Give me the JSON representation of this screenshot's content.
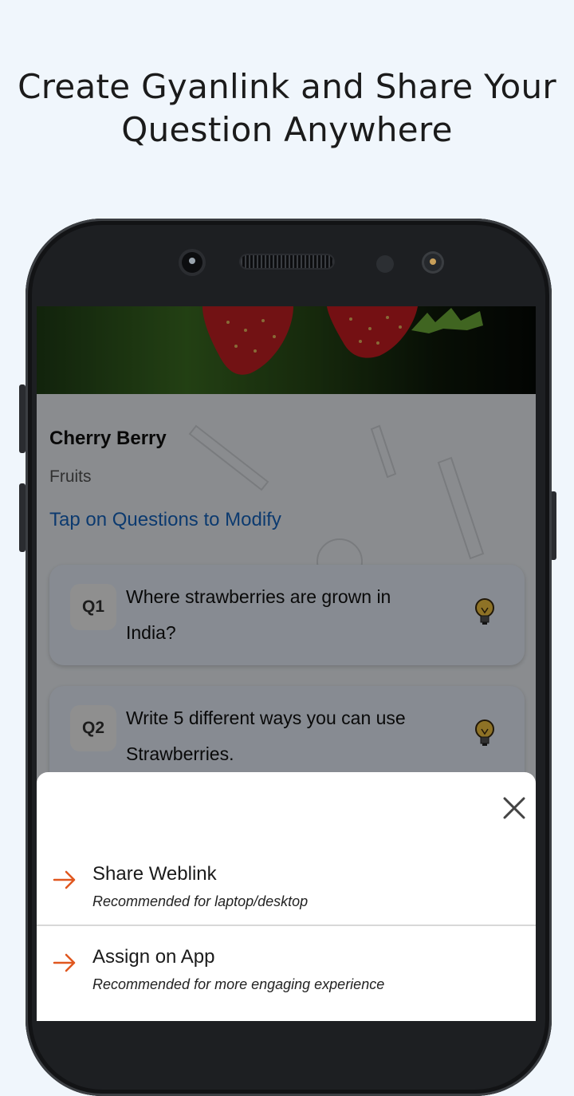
{
  "headline": {
    "line1": "Create Gyanlink and Share Your",
    "line2": "Question Anywhere"
  },
  "card": {
    "title": "Cherry Berry",
    "subtitle": "Fruits",
    "hint": "Tap on Questions to Modify"
  },
  "questions": [
    {
      "number": "Q1",
      "text": "Where strawberries are grown in India?",
      "icon": "lightbulb-icon"
    },
    {
      "number": "Q2",
      "text": "Write 5 different ways you can use Strawberries.",
      "icon": "lightbulb-icon"
    }
  ],
  "share_sheet": {
    "close_icon": "close-icon",
    "options": [
      {
        "title": "Share Weblink",
        "subtitle": "Recommended for laptop/desktop",
        "icon": "arrow-right-icon"
      },
      {
        "title": "Assign on App",
        "subtitle": "Recommended for more engaging experience",
        "icon": "arrow-right-icon"
      }
    ]
  },
  "colors": {
    "background": "#f0f6fc",
    "accent_link": "#1565c0",
    "arrow": "#e0571f",
    "phone_frame": "#1d1f22"
  }
}
